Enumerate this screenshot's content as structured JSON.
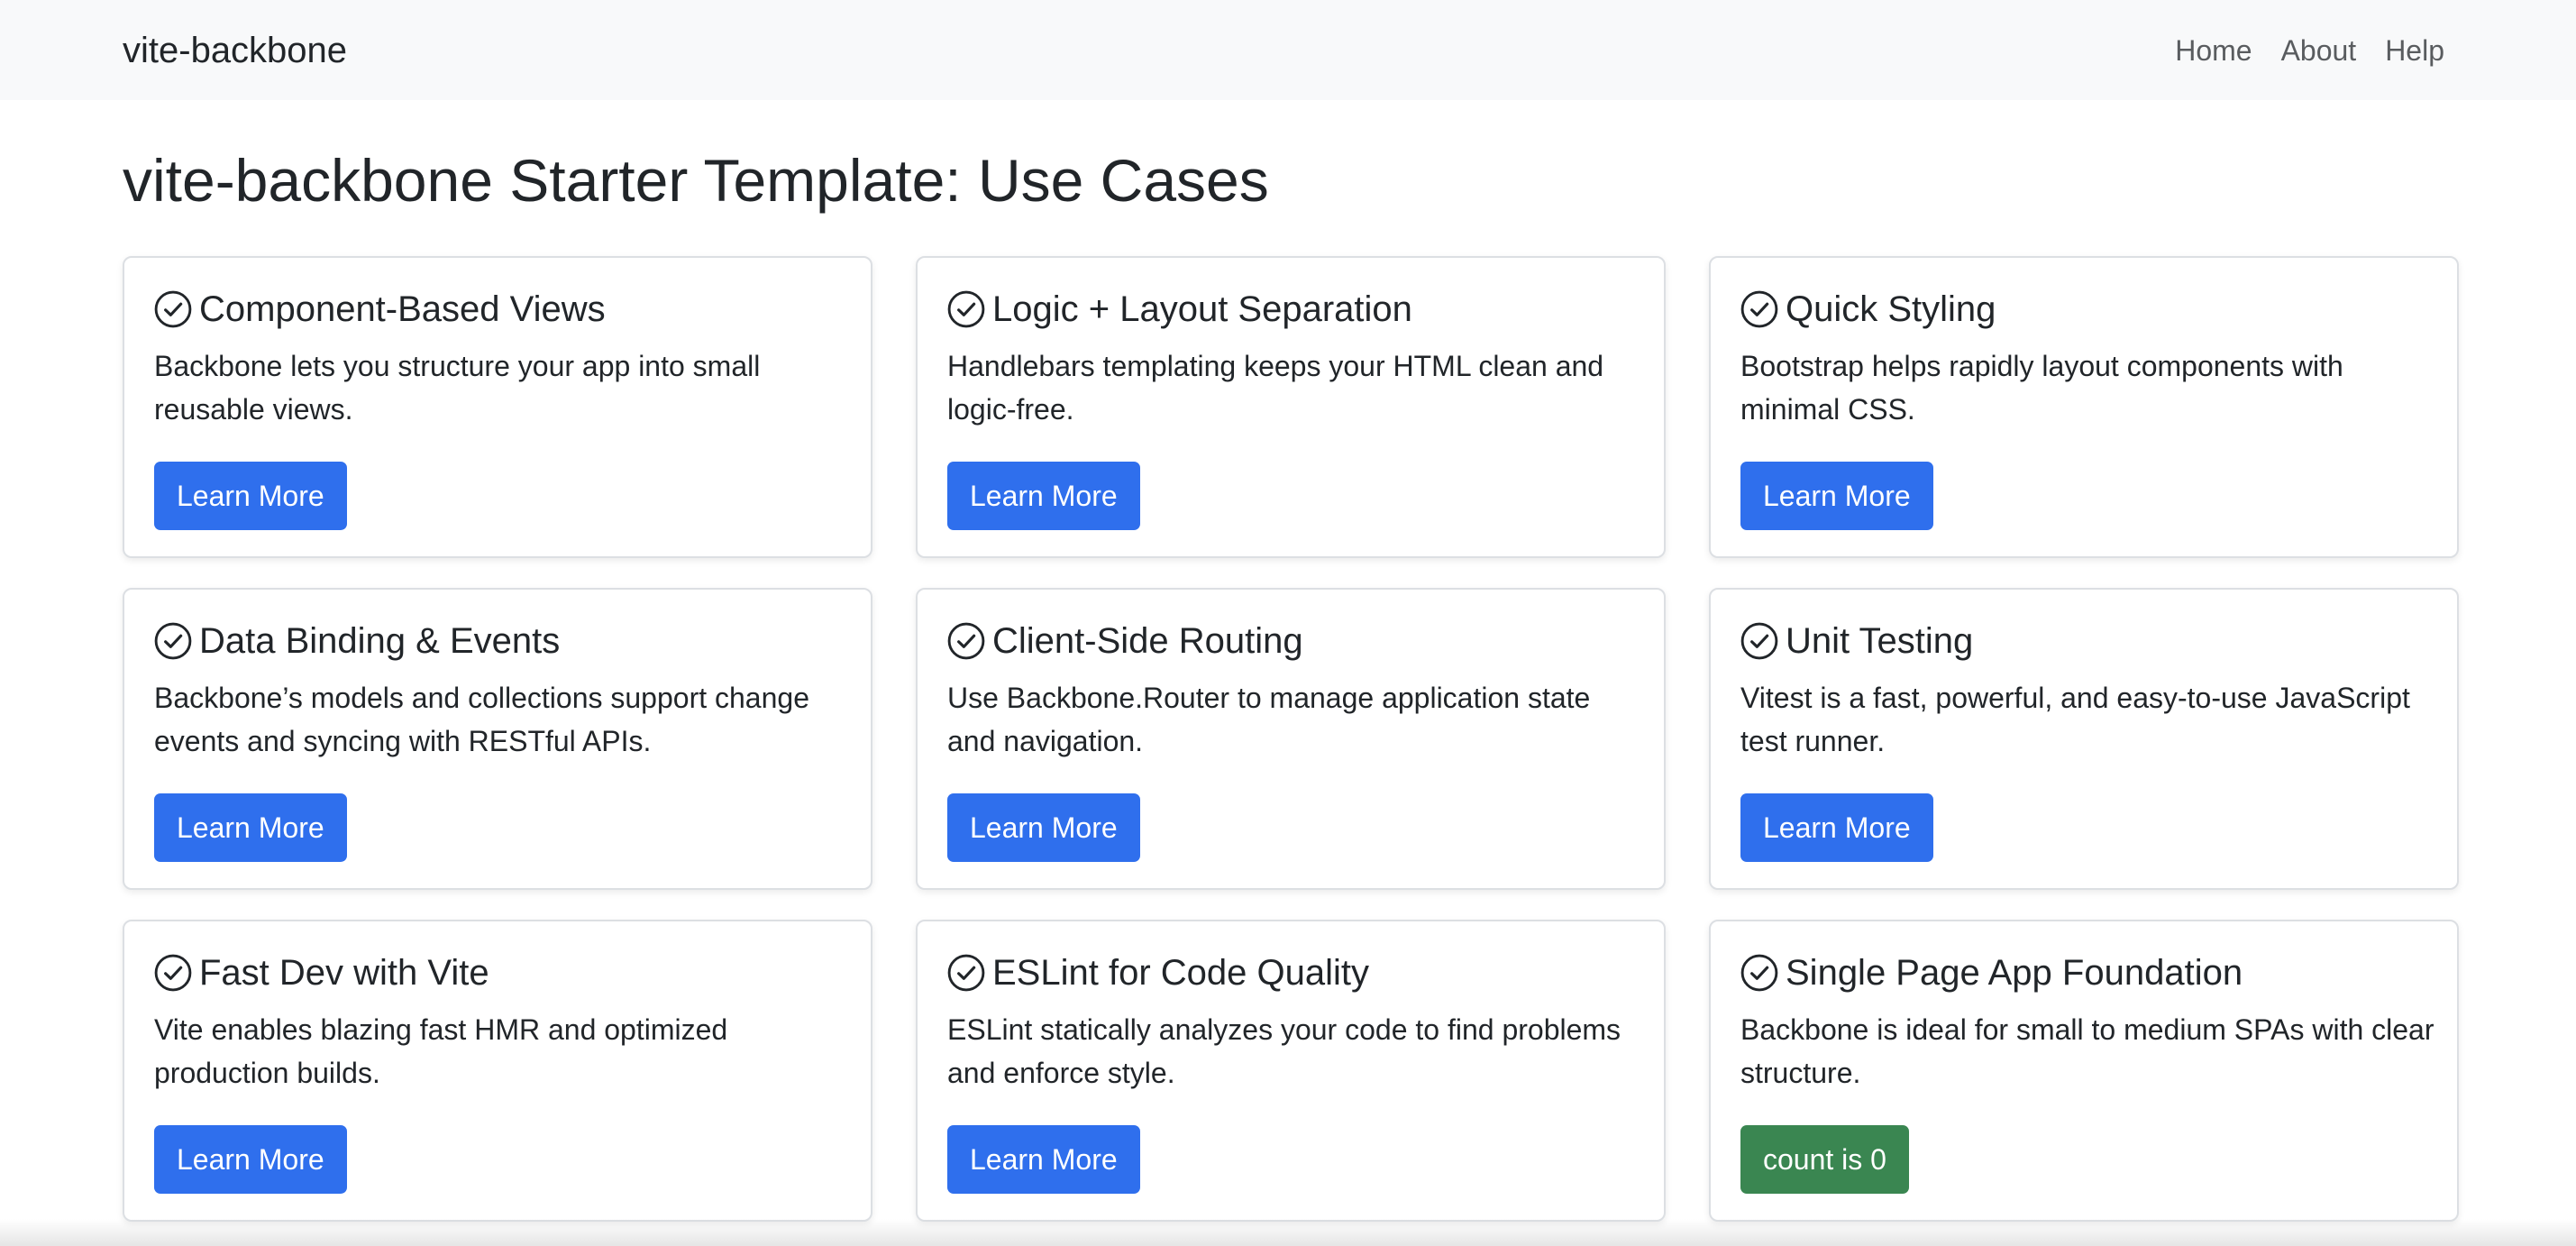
{
  "navbar": {
    "brand": "vite-backbone",
    "links": [
      "Home",
      "About",
      "Help"
    ]
  },
  "page_title": "vite-backbone Starter Template: Use Cases",
  "colors": {
    "primary_button": "#2f6fed",
    "success_button": "#3a8651",
    "navbar_bg": "#f8f9fa"
  },
  "icons": {
    "card_title_icon": "check-circle-icon"
  },
  "cards": [
    {
      "title": "Component-Based Views",
      "text": "Backbone lets you structure your app into small reusable views.",
      "button": "Learn More"
    },
    {
      "title": "Logic + Layout Separation",
      "text": "Handlebars templating keeps your HTML clean and logic-free.",
      "button": "Learn More"
    },
    {
      "title": "Quick Styling",
      "text": "Bootstrap helps rapidly layout components with minimal CSS.",
      "button": "Learn More"
    },
    {
      "title": "Data Binding & Events",
      "text": "Backbone’s models and collections support change events and syncing with RESTful APIs.",
      "button": "Learn More"
    },
    {
      "title": "Client-Side Routing",
      "text": "Use Backbone.Router to manage application state and navigation.",
      "button": "Learn More"
    },
    {
      "title": "Unit Testing",
      "text": "Vitest is a fast, powerful, and easy-to-use JavaScript test runner.",
      "button": "Learn More"
    },
    {
      "title": "Fast Dev with Vite",
      "text": "Vite enables blazing fast HMR and optimized production builds.",
      "button": "Learn More"
    },
    {
      "title": "ESLint for Code Quality",
      "text": "ESLint statically analyzes your code to find problems and enforce style.",
      "button": "Learn More"
    },
    {
      "title": "Single Page App Foundation",
      "text": "Backbone is ideal for small to medium SPAs with clear structure.",
      "button": "count is 0"
    }
  ]
}
